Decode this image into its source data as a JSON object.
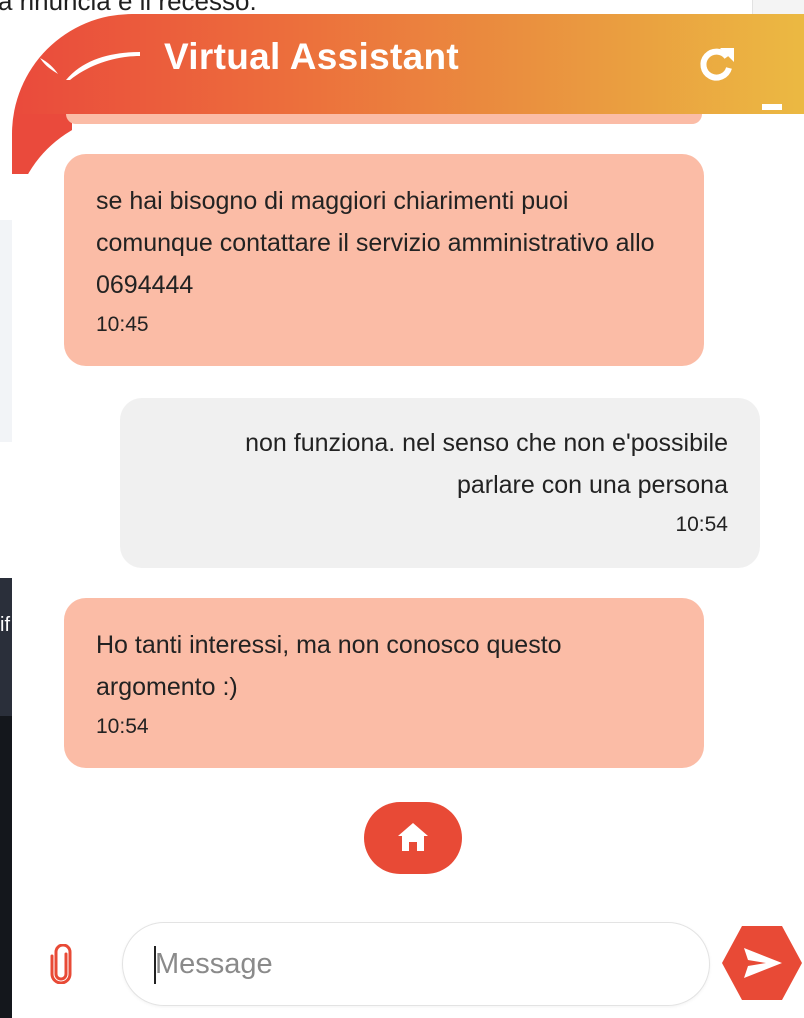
{
  "background": {
    "top_text": "a rinuncia e il recesso.",
    "side_text": "if"
  },
  "header": {
    "title": "Virtual Assistant",
    "logo_icon": "bird-wing-icon",
    "refresh_icon": "refresh-icon",
    "minimize_icon": "minimize-icon",
    "gradient": [
      "#ea4a3c",
      "#ebb942"
    ]
  },
  "messages": [
    {
      "sender": "bot",
      "text": "se hai bisogno di maggiori chiarimenti puoi comunque contattare il servizio amministrativo allo 0694444",
      "time": "10:45"
    },
    {
      "sender": "user",
      "text": "non funziona. nel senso che non e'possibile parlare con una persona",
      "time": "10:54"
    },
    {
      "sender": "bot",
      "text": "Ho tanti interessi, ma non conosco questo argomento :)",
      "time": "10:54"
    }
  ],
  "quick_actions": {
    "home_icon": "home-icon"
  },
  "composer": {
    "placeholder": "Message",
    "attach_icon": "paperclip-icon",
    "send_icon": "send-icon"
  },
  "colors": {
    "accent": "#e84a36",
    "bot_bubble": "#fbbca6",
    "user_bubble": "#f0f0f0"
  }
}
